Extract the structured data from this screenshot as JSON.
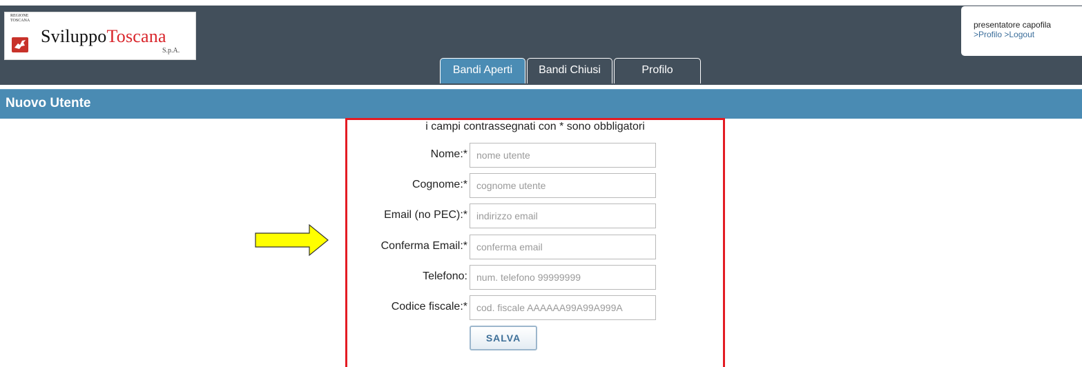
{
  "header": {
    "logo": {
      "region": "REGIONE TOSCANA",
      "brand_part1": "Sviluppo",
      "brand_part2": "Toscana",
      "suffix": "S.p.A."
    },
    "user": {
      "role": "presentatore capofila",
      "profile_link": ">Profilo",
      "logout_link": ">Logout"
    },
    "tabs": [
      {
        "label": "Bandi Aperti",
        "active": true
      },
      {
        "label": "Bandi Chiusi",
        "active": false
      },
      {
        "label": "Profilo",
        "active": false
      }
    ]
  },
  "page_title": "Nuovo Utente",
  "form": {
    "required_note": "i campi contrassegnati con * sono obbligatori",
    "fields": [
      {
        "label": "Nome:*",
        "placeholder": "nome utente",
        "value": ""
      },
      {
        "label": "Cognome:*",
        "placeholder": "cognome utente",
        "value": ""
      },
      {
        "label": "Email (no PEC):*",
        "placeholder": "indirizzo email",
        "value": ""
      },
      {
        "label": "Conferma Email:*",
        "placeholder": "conferma email",
        "value": ""
      },
      {
        "label": "Telefono:",
        "placeholder": "num. telefono 99999999",
        "value": ""
      },
      {
        "label": "Codice fiscale:*",
        "placeholder": "cod. fiscale AAAAAA99A99A999A",
        "value": ""
      }
    ],
    "save_label": "SALVA"
  },
  "annotations": {
    "arrow_color": "#ffff00",
    "highlight_color": "#e31b23"
  },
  "colors": {
    "header_bg": "#424f5b",
    "accent": "#4a8bb3",
    "brand_red": "#d9252b"
  }
}
